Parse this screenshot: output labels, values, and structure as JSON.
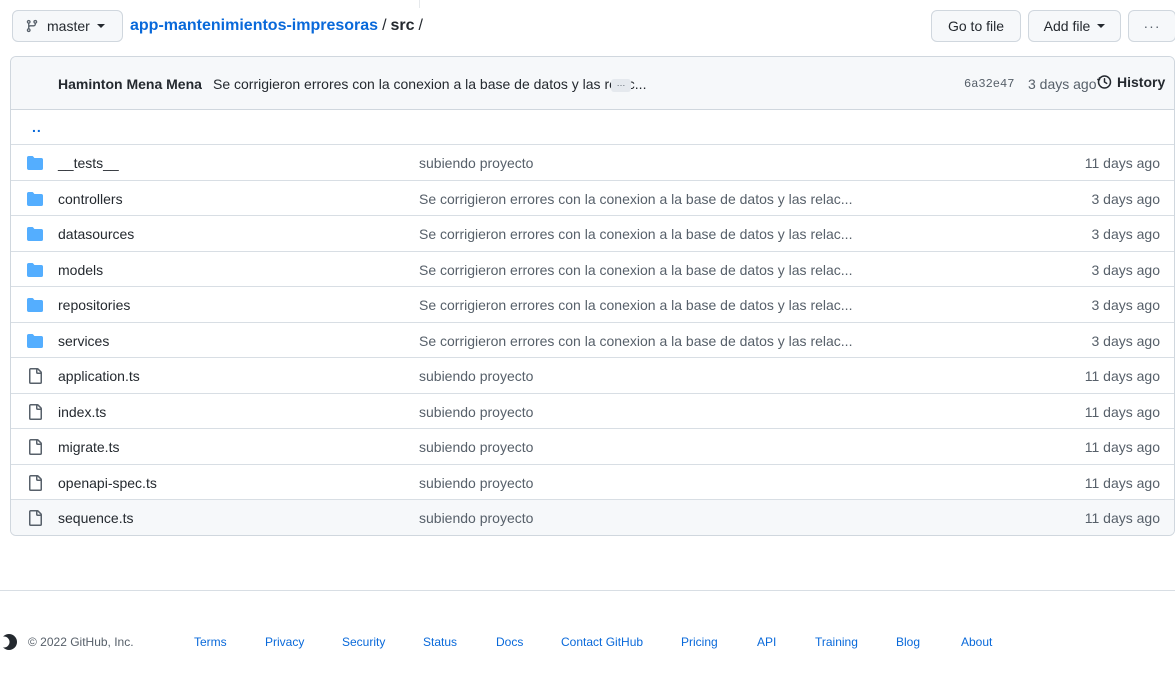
{
  "toolbar": {
    "branch": "master",
    "repo": "app-mantenimientos-impresoras",
    "separator": "/",
    "dir": "src",
    "trail": "/",
    "go_to_file": "Go to file",
    "add_file": "Add file",
    "more": "···"
  },
  "commit": {
    "author": "Haminton Mena Mena",
    "message": "Se corrigieron errores con la conexion a la base de datos y las relac...",
    "ellipsis": "…",
    "sha": "6a32e47",
    "ago": "3 days ago",
    "history": "History"
  },
  "updir": "..",
  "files": [
    {
      "type": "folder",
      "icon": "folder-icon",
      "name": "__tests__",
      "message": "subiendo proyecto",
      "age": "11 days ago"
    },
    {
      "type": "folder",
      "icon": "folder-icon",
      "name": "controllers",
      "message": "Se corrigieron errores con la conexion a la base de datos y las relac...",
      "age": "3 days ago"
    },
    {
      "type": "folder",
      "icon": "folder-icon",
      "name": "datasources",
      "message": "Se corrigieron errores con la conexion a la base de datos y las relac...",
      "age": "3 days ago"
    },
    {
      "type": "folder",
      "icon": "folder-icon",
      "name": "models",
      "message": "Se corrigieron errores con la conexion a la base de datos y las relac...",
      "age": "3 days ago"
    },
    {
      "type": "folder",
      "icon": "folder-icon",
      "name": "repositories",
      "message": "Se corrigieron errores con la conexion a la base de datos y las relac...",
      "age": "3 days ago"
    },
    {
      "type": "folder",
      "icon": "folder-icon",
      "name": "services",
      "message": "Se corrigieron errores con la conexion a la base de datos y las relac...",
      "age": "3 days ago"
    },
    {
      "type": "file",
      "icon": "file-icon",
      "name": "application.ts",
      "message": "subiendo proyecto",
      "age": "11 days ago"
    },
    {
      "type": "file",
      "icon": "file-icon",
      "name": "index.ts",
      "message": "subiendo proyecto",
      "age": "11 days ago"
    },
    {
      "type": "file",
      "icon": "file-icon",
      "name": "migrate.ts",
      "message": "subiendo proyecto",
      "age": "11 days ago"
    },
    {
      "type": "file",
      "icon": "file-icon",
      "name": "openapi-spec.ts",
      "message": "subiendo proyecto",
      "age": "11 days ago"
    },
    {
      "type": "file",
      "icon": "file-icon",
      "name": "sequence.ts",
      "message": "subiendo proyecto",
      "age": "11 days ago"
    }
  ],
  "footer": {
    "copyright": "© 2022 GitHub, Inc.",
    "links": [
      "Terms",
      "Privacy",
      "Security",
      "Status",
      "Docs",
      "Contact GitHub",
      "Pricing",
      "API",
      "Training",
      "Blog",
      "About"
    ]
  },
  "colors": {
    "link": "#0969da",
    "folder": "#54aeff",
    "muted": "#57606a",
    "border": "#d0d7de"
  }
}
